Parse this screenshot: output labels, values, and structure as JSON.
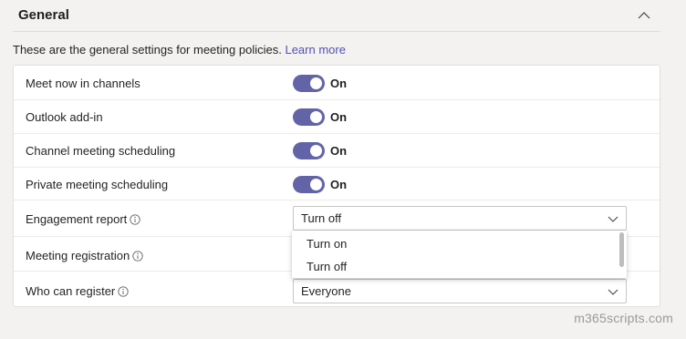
{
  "section": {
    "title": "General",
    "description": "These are the general settings for meeting policies.",
    "learn_more": "Learn more"
  },
  "settings": [
    {
      "label": "Meet now in channels",
      "type": "toggle",
      "state": "On",
      "enabled": true
    },
    {
      "label": "Outlook add-in",
      "type": "toggle",
      "state": "On",
      "enabled": true
    },
    {
      "label": "Channel meeting scheduling",
      "type": "toggle",
      "state": "On",
      "enabled": true
    },
    {
      "label": "Private meeting scheduling",
      "type": "toggle",
      "state": "On",
      "enabled": true
    },
    {
      "label": "Engagement report",
      "type": "dropdown",
      "value": "Turn off",
      "has_info": true
    },
    {
      "label": "Meeting registration",
      "type": "dropdown",
      "has_info": true
    },
    {
      "label": "Who can register",
      "type": "dropdown",
      "value": "Everyone",
      "has_info": true
    }
  ],
  "dropdown_menu": {
    "options": [
      "Turn on",
      "Turn off"
    ]
  },
  "watermark": "m365scripts.com",
  "colors": {
    "accent": "#6264a7",
    "link": "#4f52b2",
    "background": "#f3f2f1"
  },
  "icons": {
    "collapse": "chevron-up-icon",
    "info": "info-icon",
    "dropdown": "chevron-down-icon"
  }
}
